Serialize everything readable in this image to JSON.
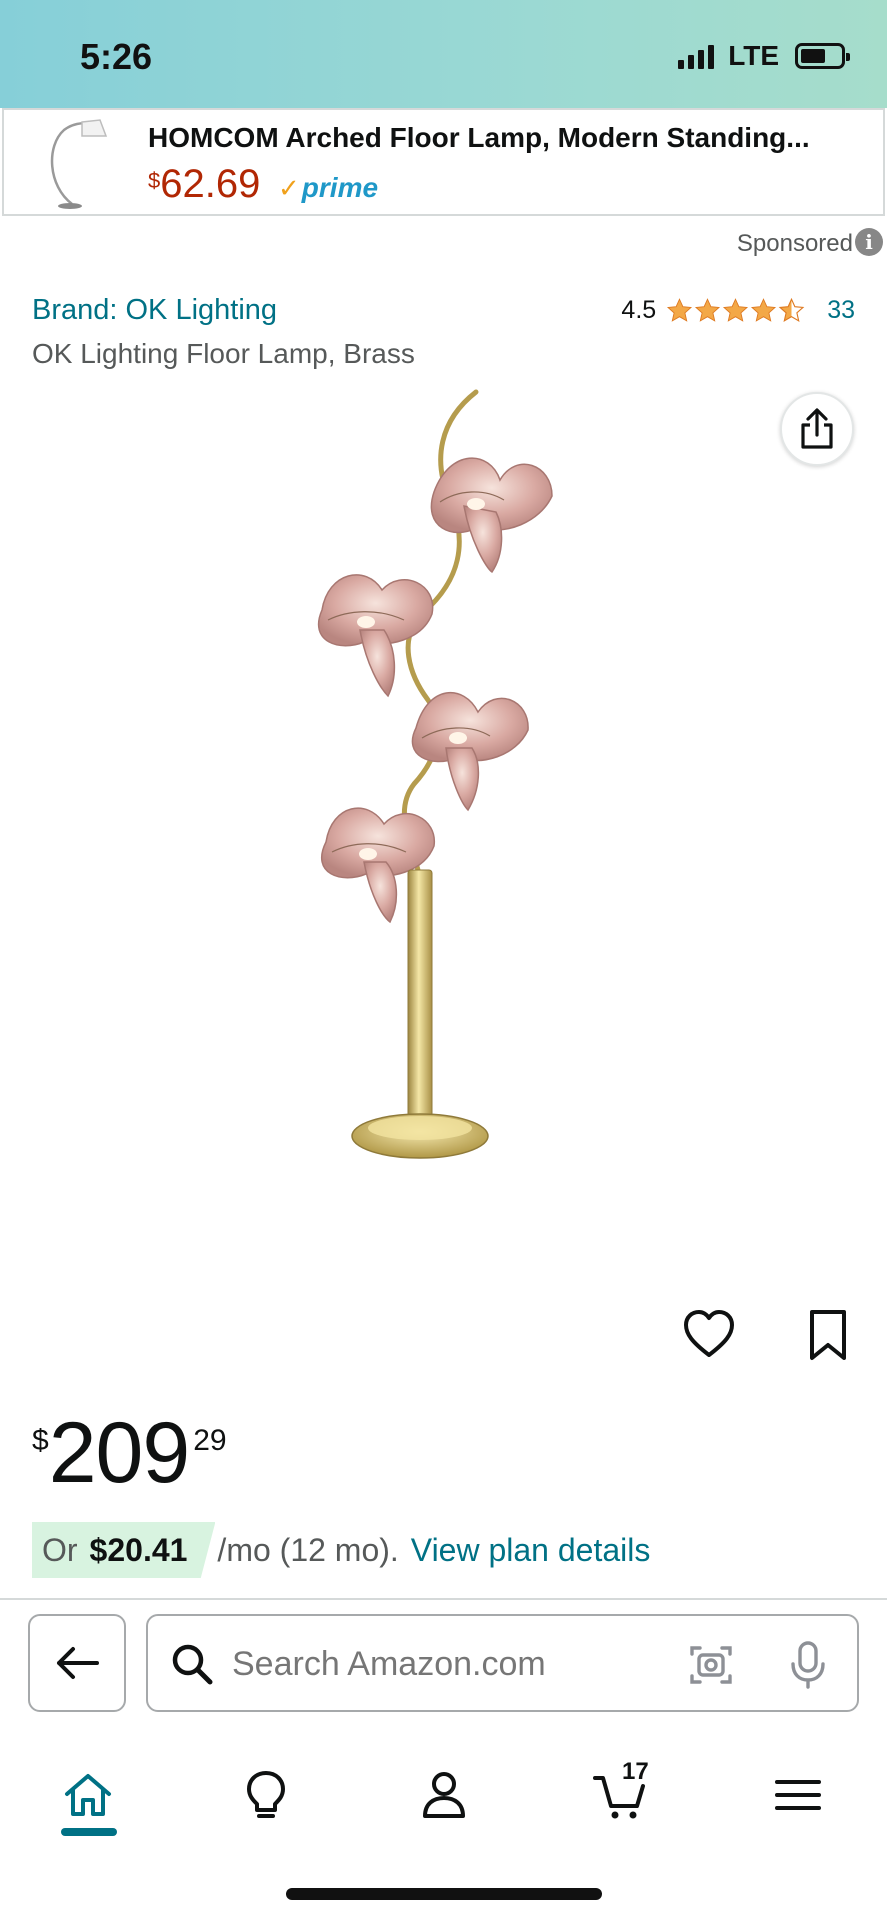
{
  "status_bar": {
    "time": "5:26",
    "network": "LTE"
  },
  "sponsored_ad": {
    "title": "HOMCOM Arched Floor Lamp, Modern Standing...",
    "price_currency": "$",
    "price_amount": "62.69",
    "prime_check": "✓",
    "prime_label": "prime",
    "sponsored_label": "Sponsored",
    "info_glyph": "i"
  },
  "product": {
    "brand": "Brand: OK Lighting",
    "title": "OK Lighting Floor Lamp, Brass",
    "rating_value": "4.5",
    "rating_stars": 4.5,
    "rating_count": "33",
    "price_currency": "$",
    "price_whole": "209",
    "price_fraction": "29",
    "monthly_or": "Or",
    "monthly_amount": "$20.41",
    "monthly_rest": "/mo (12 mo).",
    "monthly_link": "View plan details"
  },
  "search": {
    "placeholder": "Search Amazon.com"
  },
  "tabbar": {
    "cart_count": "17",
    "active_tab": "home"
  },
  "colors": {
    "link": "#007185",
    "price_red": "#b12704",
    "star": "#f3a847",
    "prime_blue": "#1f98c8",
    "installment_bg": "#d8f3e0"
  },
  "icons": [
    "signal-icon",
    "battery-icon",
    "info-icon",
    "star-icon",
    "share-icon",
    "heart-icon",
    "bookmark-icon",
    "back-arrow-icon",
    "search-icon",
    "camera-icon",
    "microphone-icon",
    "home-icon",
    "lightbulb-icon",
    "account-icon",
    "cart-icon",
    "menu-icon"
  ]
}
